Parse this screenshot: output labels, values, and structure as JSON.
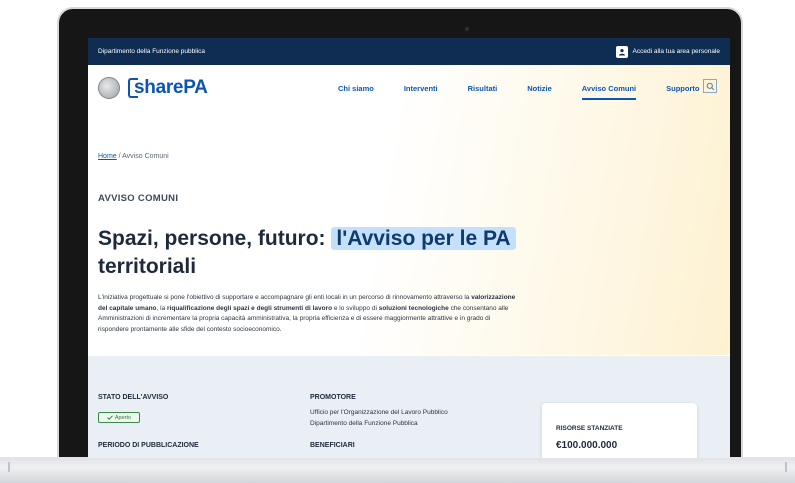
{
  "topbar": {
    "department": "Dipartimento della Funzione pubblica",
    "login_label": "Accedi alla tua area personale"
  },
  "header": {
    "brand": "sharePA",
    "nav": [
      {
        "label": "Chi siamo"
      },
      {
        "label": "Interventi"
      },
      {
        "label": "Risultati"
      },
      {
        "label": "Notizie"
      },
      {
        "label": "Avviso Comuni",
        "active": true
      },
      {
        "label": "Supporto"
      }
    ]
  },
  "breadcrumb": {
    "home": "Home",
    "separator": " / ",
    "current": "Avviso Comuni"
  },
  "hero": {
    "eyebrow": "AVVISO COMUNI",
    "title_plain": "Spazi, persone, futuro: ",
    "title_highlight": "l'Avviso per le PA",
    "title_rest": "territoriali",
    "intro": {
      "p1": "L'iniziativa progettuale si pone l'obiettivo di supportare e accompagnare gli enti locali in un percorso di rinnovamento attraverso la ",
      "b1": "valorizzazione del capitale umano",
      "p2": ", la ",
      "b2": "riqualificazione degli spazi e degli strumenti di lavoro",
      "p3": " e lo sviluppo di ",
      "b3": "soluzioni tecnologiche",
      "p4": " che consentano alle Amministrazioni di incrementare la propria capacità amministrativa, la propria efficienza e di essere maggiormente attrattive e in grado di rispondere prontamente alle sfide del contesto socioeconomico."
    }
  },
  "details": {
    "status_label": "STATO DELL'AVVISO",
    "status_value": "Aperto",
    "period_label": "PERIODO DI PUBBLICAZIONE",
    "promoter_label": "PROMOTORE",
    "promoter_line1": "Ufficio per l'Organizzazione del Lavoro Pubblico",
    "promoter_line2": "Dipartimento della Funzione Pubblica",
    "beneficiaries_label": "BENEFICIARI",
    "resources_label": "RISORSE STANZIATE",
    "resources_value": "€100.000.000"
  },
  "colors": {
    "topbar": "#0f2d52",
    "accent": "#0b56b3",
    "highlight": "#c5e0fb",
    "status_green": "#2e7d3d"
  },
  "icons": {
    "emblem": "italian-republic-emblem-icon",
    "login": "user-icon",
    "search": "search-icon",
    "badge": "check-icon"
  }
}
